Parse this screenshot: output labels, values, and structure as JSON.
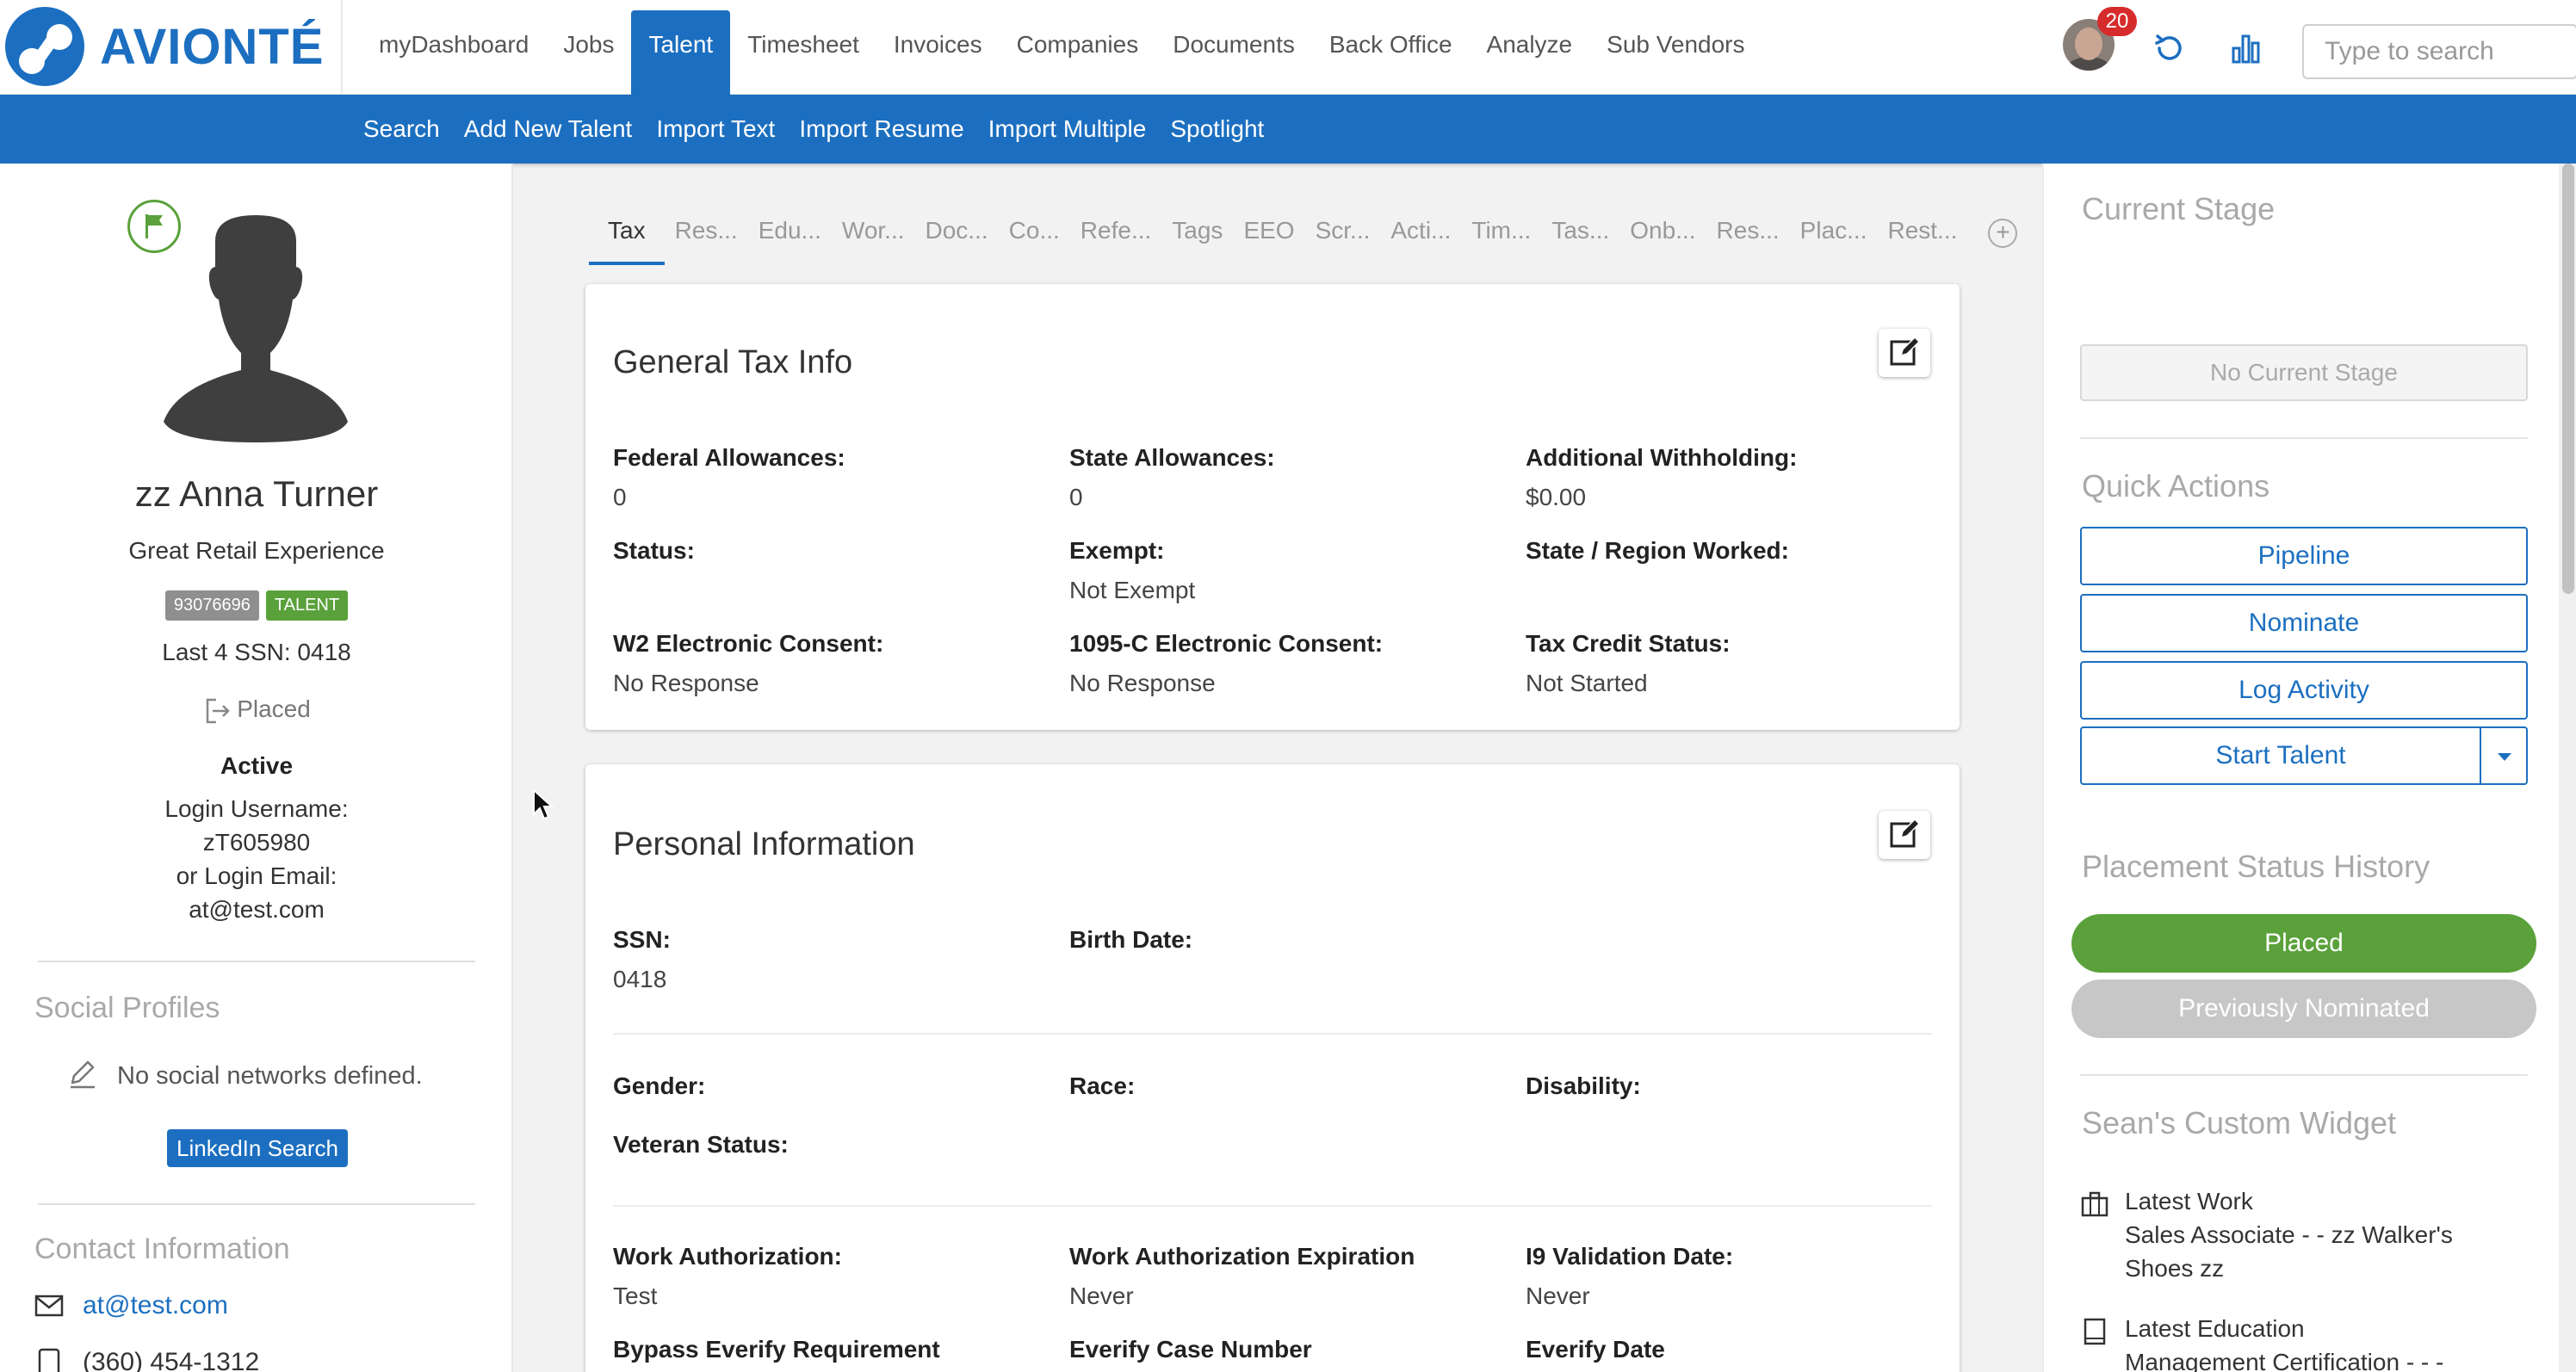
{
  "brand": {
    "name": "AVIONTÉ",
    "color": "#1c6fc0"
  },
  "nav": {
    "items": [
      "myDashboard",
      "Jobs",
      "Talent",
      "Timesheet",
      "Invoices",
      "Companies",
      "Documents",
      "Back Office",
      "Analyze",
      "Sub Vendors"
    ],
    "active": "Talent",
    "notifications": "20",
    "search_placeholder": "Type to search"
  },
  "subnav": {
    "items": [
      "Search",
      "Add New Talent",
      "Import Text",
      "Import Resume",
      "Import Multiple",
      "Spotlight"
    ]
  },
  "profile": {
    "name": "zz Anna Turner",
    "headline": "Great Retail Experience",
    "id_badge": "93076696",
    "type_badge": "TALENT",
    "last4_ssn": "Last 4 SSN: 0418",
    "placement_status": "Placed",
    "active": "Active",
    "login_username_label": "Login Username:",
    "login_username": "zT605980",
    "login_email_label": "or Login Email:",
    "login_email": "at@test.com"
  },
  "social": {
    "title": "Social Profiles",
    "empty": "No social networks defined.",
    "linkedin_button": "LinkedIn Search"
  },
  "contact": {
    "title": "Contact Information",
    "email": "at@test.com",
    "phone": "(360) 454-1312"
  },
  "tabs": [
    "Tax",
    "Res...",
    "Edu...",
    "Wor...",
    "Doc...",
    "Co...",
    "Refe...",
    "Tags",
    "EEO",
    "Scr...",
    "Acti...",
    "Tim...",
    "Tas...",
    "Onb...",
    "Res...",
    "Plac...",
    "Rest..."
  ],
  "tax": {
    "title": "General Tax Info",
    "federal_allowances": {
      "label": "Federal Allowances:",
      "value": "0"
    },
    "state_allowances": {
      "label": "State Allowances:",
      "value": "0"
    },
    "additional_withholding": {
      "label": "Additional Withholding:",
      "value": "$0.00"
    },
    "status": {
      "label": "Status:",
      "value": ""
    },
    "exempt": {
      "label": "Exempt:",
      "value": "Not Exempt"
    },
    "state_region": {
      "label": "State / Region Worked:",
      "value": ""
    },
    "w2_consent": {
      "label": "W2 Electronic Consent:",
      "value": "No Response"
    },
    "c1095_consent": {
      "label": "1095-C Electronic Consent:",
      "value": "No Response"
    },
    "tax_credit": {
      "label": "Tax Credit Status:",
      "value": "Not Started"
    }
  },
  "personal": {
    "title": "Personal Information",
    "ssn": {
      "label": "SSN:",
      "value": "0418"
    },
    "birth_date": {
      "label": "Birth Date:",
      "value": ""
    },
    "gender": {
      "label": "Gender:",
      "value": ""
    },
    "race": {
      "label": "Race:",
      "value": ""
    },
    "disability": {
      "label": "Disability:",
      "value": ""
    },
    "veteran": {
      "label": "Veteran Status:",
      "value": ""
    },
    "work_auth": {
      "label": "Work Authorization:",
      "value": "Test"
    },
    "work_auth_exp": {
      "label": "Work Authorization Expiration",
      "value": "Never"
    },
    "i9_date": {
      "label": "I9 Validation Date:",
      "value": "Never"
    },
    "bypass_everify": {
      "label": "Bypass Everify Requirement",
      "value": ""
    },
    "everify_case": {
      "label": "Everify Case Number",
      "value": ""
    },
    "everify_date": {
      "label": "Everify Date",
      "value": ""
    }
  },
  "right": {
    "current_stage_title": "Current Stage",
    "no_stage": "No Current Stage",
    "quick_actions_title": "Quick Actions",
    "pipeline": "Pipeline",
    "nominate": "Nominate",
    "log_activity": "Log Activity",
    "start_talent": "Start Talent",
    "placement_history_title": "Placement Status History",
    "placed": "Placed",
    "previously_nominated": "Previously Nominated",
    "custom_widget_title": "Sean's Custom Widget",
    "latest_work_label": "Latest Work",
    "latest_work_value": "Sales Associate - - zz Walker's Shoes zz",
    "latest_education_label": "Latest Education",
    "latest_education_value": "Management Certification - - -"
  },
  "colors": {
    "primary": "#1c6fc0",
    "success": "#5aa13b",
    "muted": "#a9a9a9"
  }
}
